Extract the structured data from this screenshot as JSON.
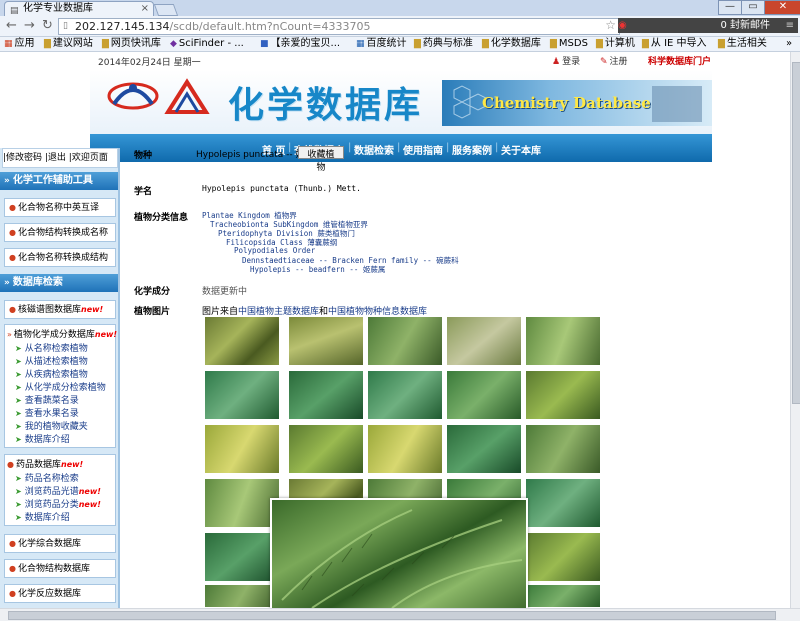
{
  "browser": {
    "tab_title": "化学专业数据库",
    "tab_close": "×",
    "url_host": "202.127.145.134",
    "url_path": "/scdb/default.htm?nCount=4333705",
    "mail_widget": "封新邮件",
    "mail_count": "0",
    "bookmarks": [
      {
        "label": "应用",
        "icon": "apps-grid-icon"
      },
      {
        "label": "建议网站",
        "icon": "folder-icon"
      },
      {
        "label": "网页快讯库",
        "icon": "folder-icon"
      },
      {
        "label": "SciFinder - ...",
        "icon": "scifinder-icon"
      },
      {
        "label": "【亲爱的宝贝...",
        "icon": "favicon-icon"
      },
      {
        "label": "百度统计",
        "icon": "baidu-icon"
      },
      {
        "label": "药典与标准",
        "icon": "folder-icon"
      },
      {
        "label": "化学数据库",
        "icon": "folder-icon"
      },
      {
        "label": "MSDS",
        "icon": "folder-icon"
      },
      {
        "label": "计算机",
        "icon": "folder-icon"
      },
      {
        "label": "从 IE 中导入",
        "icon": "folder-icon"
      },
      {
        "label": "生活相关",
        "icon": "folder-icon"
      }
    ],
    "overflow": "»"
  },
  "header": {
    "date": "2014年02月24日 星期一",
    "login": "登录",
    "register": "注册",
    "portal": "科学数据库门户",
    "site_title": "化学数据库",
    "site_title_en": "Chemistry Database"
  },
  "main_nav": [
    "首 页",
    "查找数据库",
    "数据检索",
    "使用指南",
    "服务案例",
    "关于本库"
  ],
  "sidebar": {
    "user_links": "|修改密码  |退出  |欢迎页面",
    "tools_heading": "化学工作辅助工具",
    "tools": [
      "化合物名称中英互译",
      "化合物结构转换成名称",
      "化合物名称转换成结构"
    ],
    "db_heading": "数据库检索",
    "nmr_db": "核磁谱图数据库",
    "phyto_db": "植物化学成分数据库",
    "phyto_subs": [
      "从名称检索植物",
      "从描述检索植物",
      "从疾病检索植物",
      "从化学成分检索植物",
      "查看蔬菜名录",
      "查看水果名录",
      "我的植物收藏夹",
      "数据库介绍"
    ],
    "drug_db": "药品数据库",
    "drug_subs": [
      "药品名称检索",
      "浏览药品光谱",
      "浏览药品分类",
      "数据库介绍"
    ],
    "drug_new_flags": [
      false,
      true,
      true,
      false
    ],
    "more": [
      "化学综合数据库",
      "化合物结构数据库",
      "化学反应数据库"
    ],
    "new_badge": "new!"
  },
  "plant": {
    "species_label": "物种",
    "species_value": "Hypolepis punctata -- 姬蕨",
    "collect_button": "收藏植物",
    "sciname_label": "学名",
    "sciname_value": "Hypolepis punctata (Thunb.) Mett.",
    "taxonomy_label": "植物分类信息",
    "taxonomy": [
      {
        "latin": "Plantae Kingdom",
        "cn": "植物界"
      },
      {
        "latin": "Tracheobionta SubKingdom",
        "cn": "维管植物亚界"
      },
      {
        "latin": "Pteridophyta Division",
        "cn": "蕨类植物门"
      },
      {
        "latin": "Filicopsida Class",
        "cn": "薄囊蕨纲"
      },
      {
        "latin": "Polypodiales Order",
        "cn": ""
      },
      {
        "latin": "Dennstaedtiaceae -- Bracken Fern family --",
        "cn": "碗蕨科"
      },
      {
        "latin": "Hypolepis -- beadfern --",
        "cn": "姬蕨属"
      }
    ],
    "chem_label": "化学成分",
    "chem_value": "数据更新中",
    "photos_label": "植物图片",
    "photos_src_pre": "图片来自",
    "photos_src_a": "中国植物主题数据库",
    "photos_src_and": "和",
    "photos_src_b": "中国植物物种信息数据库"
  },
  "colors": {
    "nav_blue": "#1f72b8",
    "title_blue": "#1787c8",
    "link_blue": "#1a3d8a",
    "new_red": "#e00000"
  }
}
